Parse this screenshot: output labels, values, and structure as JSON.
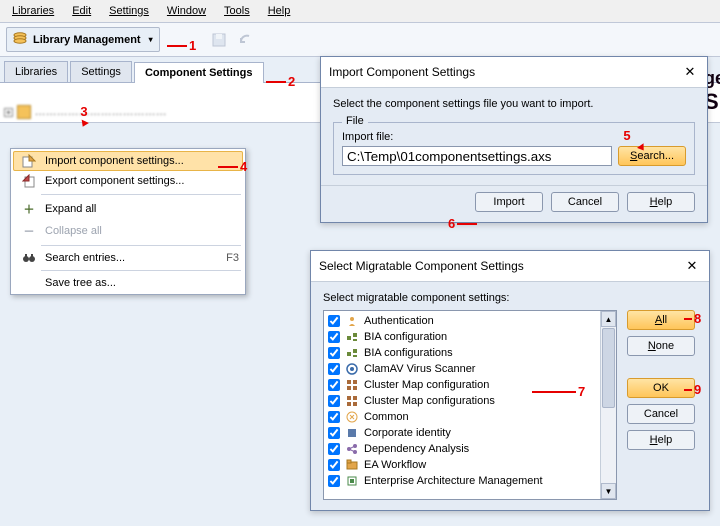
{
  "menubar": {
    "items": [
      "Libraries",
      "Edit",
      "Settings",
      "Window",
      "Tools",
      "Help"
    ]
  },
  "toolbar": {
    "library_btn": "Library Management"
  },
  "tabs": {
    "items": [
      "Libraries",
      "Settings",
      "Component Settings"
    ],
    "active": 2
  },
  "tree": {
    "root_label": "………………………………"
  },
  "context_menu": {
    "import": "Import component settings...",
    "export": "Export component settings...",
    "expand": "Expand all",
    "collapse": "Collapse all",
    "search": "Search entries...",
    "search_shortcut": "F3",
    "save_tree": "Save tree as..."
  },
  "dlg_import": {
    "title": "Import Component Settings",
    "instruction": "Select the component settings file you want to import.",
    "group_label": "File",
    "field_label": "Import file:",
    "file_value": "C:\\Temp\\01componentsettings.axs",
    "search_btn": "Search...",
    "import_btn": "Import",
    "cancel_btn": "Cancel",
    "help_btn": "Help"
  },
  "dlg_migrate": {
    "title": "Select Migratable Component Settings",
    "instruction": "Select migratable component settings:",
    "items": [
      "Authentication",
      "BIA configuration",
      "BIA configurations",
      "ClamAV Virus Scanner",
      "Cluster Map configuration",
      "Cluster Map configurations",
      "Common",
      "Corporate identity",
      "Dependency Analysis",
      "EA Workflow",
      "Enterprise Architecture Management"
    ],
    "all_btn": "All",
    "none_btn": "None",
    "ok_btn": "OK",
    "cancel_btn": "Cancel",
    "help_btn": "Help"
  },
  "annotations": {
    "a1": "1",
    "a2": "2",
    "a3": "3",
    "a4": "4",
    "a5": "5",
    "a6": "6",
    "a7": "7",
    "a8": "8",
    "a9": "9"
  }
}
